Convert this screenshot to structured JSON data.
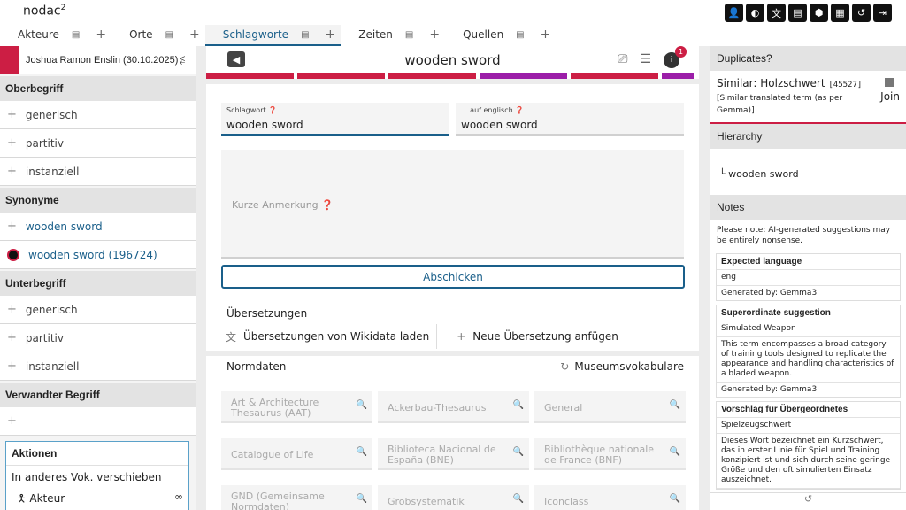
{
  "app": {
    "title": "nodac",
    "title_sup": "2"
  },
  "top_icons": [
    "user-icon",
    "contrast-icon",
    "translate-icon",
    "book-icon",
    "shield-icon",
    "grid-icon",
    "history-icon",
    "logout-icon"
  ],
  "tabs": [
    {
      "label": "Akteure",
      "active": false
    },
    {
      "label": "Orte",
      "active": false
    },
    {
      "label": "Schlagworte",
      "active": true
    },
    {
      "label": "Zeiten",
      "active": false
    },
    {
      "label": "Quellen",
      "active": false
    }
  ],
  "left": {
    "user": "Joshua Ramon Enslin (30.10.2025)",
    "sections": {
      "oberbegriff": {
        "title": "Oberbegriff",
        "items": [
          "generisch",
          "partitiv",
          "instanziell"
        ]
      },
      "synonyme": {
        "title": "Synonyme",
        "add_value": "wooden sword",
        "existing": "wooden sword (196724)"
      },
      "unterbegriff": {
        "title": "Unterbegriff",
        "items": [
          "generisch",
          "partitiv",
          "instanziell"
        ]
      },
      "verwandter": {
        "title": "Verwandter Begriff"
      }
    },
    "actions": {
      "title": "Aktionen",
      "move": "In anderes Vok. verschieben",
      "target": "Akteur"
    }
  },
  "center": {
    "title": "wooden sword",
    "notification_count": "1",
    "strip_colors": [
      "#cc1e44",
      "#cc1e44",
      "#cc1e44",
      "#9b1ea8",
      "#cc1e44",
      "#9b1ea8"
    ],
    "form": {
      "schlagwort_label": "Schlagwort",
      "schlagwort_value": "wooden sword",
      "englisch_label": "... auf englisch",
      "englisch_value": "wooden sword",
      "note_placeholder": "Kurze Anmerkung",
      "submit": "Abschicken"
    },
    "translations": {
      "title": "Übersetzungen",
      "wikidata": "Übersetzungen von Wikidata laden",
      "add": "Neue Übersetzung anfügen"
    },
    "normdaten": {
      "title": "Normdaten",
      "museum": "Museumsvokabulare",
      "fields": [
        "Art & Architecture Thesaurus (AAT)",
        "Ackerbau-Thesaurus",
        "General",
        "Catalogue of Life",
        "Biblioteca Nacional de España (BNE)",
        "Bibliothèque nationale de France (BNF)",
        "GND (Gemeinsame Normdaten)",
        "Grobsystematik",
        "Iconclass"
      ]
    }
  },
  "right": {
    "duplicates": {
      "title": "Duplicates?",
      "similar": "Similar: Holzschwert",
      "id": "[45527]",
      "sub": "[Similar translated term (as per Gemma)]",
      "join": "Join"
    },
    "hierarchy": {
      "title": "Hierarchy",
      "item": "wooden sword"
    },
    "notes": {
      "title": "Notes",
      "intro": "Please note: AI-generated suggestions may be entirely nonsense.",
      "cards": [
        {
          "title": "Expected language",
          "value": "eng",
          "body": "",
          "generated": "Generated by: Gemma3"
        },
        {
          "title": "Superordinate suggestion",
          "value": "Simulated Weapon",
          "body": "This term encompasses a broad category of training tools designed to replicate the appearance and handling characteristics of a bladed weapon.",
          "generated": "Generated by: Gemma3"
        },
        {
          "title": "Vorschlag für Übergeordnetes",
          "value": "Spielzeugschwert",
          "body": "Dieses Wort bezeichnet ein Kurzschwert, das in erster Linie für Spiel und Training konzipiert ist und sich durch seine geringe Größe und den oft simulierten Einsatz auszeichnet.",
          "generated": ""
        }
      ]
    }
  }
}
